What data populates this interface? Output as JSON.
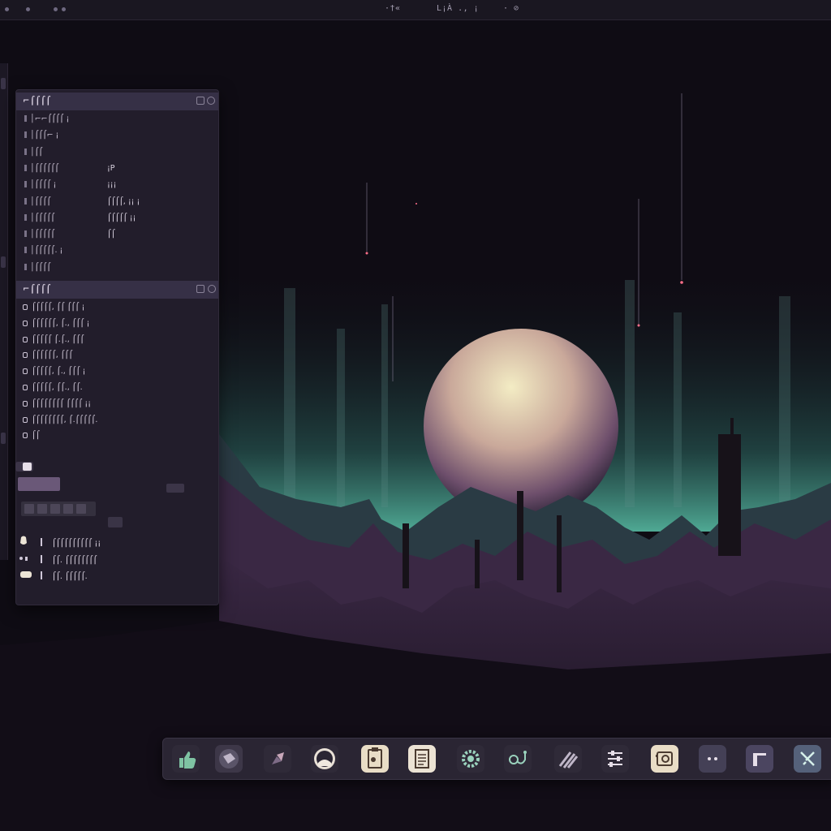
{
  "topbar": {
    "left_glyph": "· ▪",
    "center_left": "·†«­",
    "center": "L¡À ., ¡",
    "right": "· ⊘"
  },
  "panel": {
    "section1": {
      "title": "⌐⌠⌠⌠⌠",
      "rows": [
        {
          "key": "│⌐⌐⌠⌠⌠⌠ ¡",
          "value": ""
        },
        {
          "key": "│⌠⌠⌠⌐ ¡",
          "value": ""
        },
        {
          "key": "│⌠⌠",
          "value": ""
        },
        {
          "key": "│⌠⌠⌠⌠⌠⌠",
          "value": "¡P"
        },
        {
          "key": "│⌠⌠⌠⌠ ¡",
          "value": "¡¡¡"
        },
        {
          "key": "│⌠⌠⌠⌠",
          "value": "⌠⌠⌠⌠, ¡¡ ¡"
        },
        {
          "key": "│⌠⌠⌠⌠⌠",
          "value": "⌠⌠⌠⌠⌠ ¡¡"
        },
        {
          "key": "│⌠⌠⌠⌠⌠",
          "value": "⌠⌠"
        },
        {
          "key": "│⌠⌠⌠⌠⌠. ¡",
          "value": ""
        },
        {
          "key": "│⌠⌠⌠⌠",
          "value": ""
        }
      ]
    },
    "section2": {
      "title": "⌐⌠⌠⌠⌠",
      "items": [
        "⌠⌠⌠⌠⌠, ⌠⌠ ⌠⌠⌠ ¡",
        "⌠⌠⌠⌠⌠⌠, ⌠., ⌠⌠⌠ ¡",
        "⌠⌠⌠⌠⌠ ⌠.⌠., ⌠⌠⌠",
        "⌠⌠⌠⌠⌠⌠, ⌠⌠⌠",
        "⌠⌠⌠⌠⌠, ⌠., ⌠⌠⌠ ¡",
        "⌠⌠⌠⌠⌠, ⌠⌠., ⌠⌠.",
        "⌠⌠⌠⌠⌠⌠⌠⌠ ⌠⌠⌠⌠ ¡¡",
        "⌠⌠⌠⌠⌠⌠⌠⌠, ⌠.⌠⌠⌠⌠⌠.",
        "⌠⌠"
      ]
    },
    "devices": [
      {
        "label": "⌠⌠⌠⌠⌠⌠⌠⌠⌠⌠ ¡¡"
      },
      {
        "label": "⌠⌠. ⌠⌠⌠⌠⌠⌠⌠⌠"
      },
      {
        "label": "⌠⌠. ⌠⌠⌠⌠⌠."
      }
    ]
  },
  "dock": {
    "items": [
      {
        "icon": "thumbs-up-icon",
        "bg": "#2f2a38",
        "fg": "#7fc3a3"
      },
      {
        "icon": "eraser-icon",
        "bg": "#3d3748",
        "fg": "#bfb6c8"
      },
      {
        "icon": "shapes-icon",
        "bg": "#2f2a38",
        "fg": "#c8a7b9"
      },
      {
        "icon": "disc-icon",
        "bg": "#2f2a38",
        "fg": "#f0e9e0"
      },
      {
        "icon": "clipboard-icon",
        "bg": "#e9ddc6",
        "fg": "#4b3b30"
      },
      {
        "icon": "document-icon",
        "bg": "#ece3d4",
        "fg": "#4b3b30"
      },
      {
        "icon": "gear-icon",
        "bg": "#2f2a38",
        "fg": "#9ad2bd"
      },
      {
        "icon": "link-icon",
        "bg": "#2f2a38",
        "fg": "#9ad2bd"
      },
      {
        "icon": "stripes-icon",
        "bg": "#2f2a38",
        "fg": "#bfb6c8"
      },
      {
        "icon": "sliders-icon",
        "bg": "#2f2a38",
        "fg": "#e7dfe9"
      },
      {
        "icon": "camera-icon",
        "bg": "#e9ddc6",
        "fg": "#4b3b30"
      },
      {
        "icon": "dots-icon",
        "bg": "#444056",
        "fg": "#e7dfe9"
      },
      {
        "icon": "folder-icon",
        "bg": "#4b4560",
        "fg": "#e7dfe9"
      },
      {
        "icon": "tools-icon",
        "bg": "#55617a",
        "fg": "#d6f0ea"
      }
    ]
  },
  "colors": {
    "sky": "#0f0c14",
    "planet": "#e7d1a8",
    "glow": "#7ad2b8",
    "mountains": "#3a2844"
  }
}
